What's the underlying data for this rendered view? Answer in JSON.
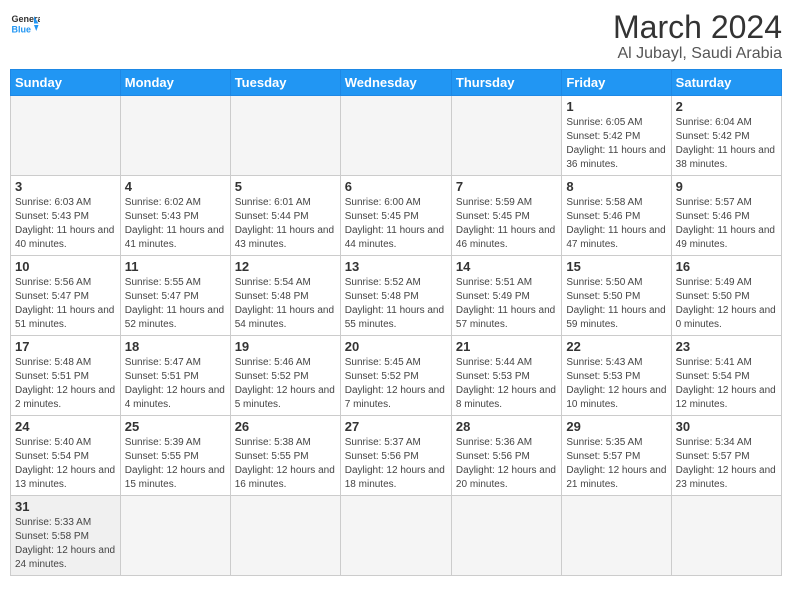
{
  "header": {
    "logo_general": "General",
    "logo_blue": "Blue",
    "title": "March 2024",
    "subtitle": "Al Jubayl, Saudi Arabia"
  },
  "weekdays": [
    "Sunday",
    "Monday",
    "Tuesday",
    "Wednesday",
    "Thursday",
    "Friday",
    "Saturday"
  ],
  "weeks": [
    [
      {
        "day": "",
        "info": ""
      },
      {
        "day": "",
        "info": ""
      },
      {
        "day": "",
        "info": ""
      },
      {
        "day": "",
        "info": ""
      },
      {
        "day": "",
        "info": ""
      },
      {
        "day": "1",
        "info": "Sunrise: 6:05 AM\nSunset: 5:42 PM\nDaylight: 11 hours and 36 minutes."
      },
      {
        "day": "2",
        "info": "Sunrise: 6:04 AM\nSunset: 5:42 PM\nDaylight: 11 hours and 38 minutes."
      }
    ],
    [
      {
        "day": "3",
        "info": "Sunrise: 6:03 AM\nSunset: 5:43 PM\nDaylight: 11 hours and 40 minutes."
      },
      {
        "day": "4",
        "info": "Sunrise: 6:02 AM\nSunset: 5:43 PM\nDaylight: 11 hours and 41 minutes."
      },
      {
        "day": "5",
        "info": "Sunrise: 6:01 AM\nSunset: 5:44 PM\nDaylight: 11 hours and 43 minutes."
      },
      {
        "day": "6",
        "info": "Sunrise: 6:00 AM\nSunset: 5:45 PM\nDaylight: 11 hours and 44 minutes."
      },
      {
        "day": "7",
        "info": "Sunrise: 5:59 AM\nSunset: 5:45 PM\nDaylight: 11 hours and 46 minutes."
      },
      {
        "day": "8",
        "info": "Sunrise: 5:58 AM\nSunset: 5:46 PM\nDaylight: 11 hours and 47 minutes."
      },
      {
        "day": "9",
        "info": "Sunrise: 5:57 AM\nSunset: 5:46 PM\nDaylight: 11 hours and 49 minutes."
      }
    ],
    [
      {
        "day": "10",
        "info": "Sunrise: 5:56 AM\nSunset: 5:47 PM\nDaylight: 11 hours and 51 minutes."
      },
      {
        "day": "11",
        "info": "Sunrise: 5:55 AM\nSunset: 5:47 PM\nDaylight: 11 hours and 52 minutes."
      },
      {
        "day": "12",
        "info": "Sunrise: 5:54 AM\nSunset: 5:48 PM\nDaylight: 11 hours and 54 minutes."
      },
      {
        "day": "13",
        "info": "Sunrise: 5:52 AM\nSunset: 5:48 PM\nDaylight: 11 hours and 55 minutes."
      },
      {
        "day": "14",
        "info": "Sunrise: 5:51 AM\nSunset: 5:49 PM\nDaylight: 11 hours and 57 minutes."
      },
      {
        "day": "15",
        "info": "Sunrise: 5:50 AM\nSunset: 5:50 PM\nDaylight: 11 hours and 59 minutes."
      },
      {
        "day": "16",
        "info": "Sunrise: 5:49 AM\nSunset: 5:50 PM\nDaylight: 12 hours and 0 minutes."
      }
    ],
    [
      {
        "day": "17",
        "info": "Sunrise: 5:48 AM\nSunset: 5:51 PM\nDaylight: 12 hours and 2 minutes."
      },
      {
        "day": "18",
        "info": "Sunrise: 5:47 AM\nSunset: 5:51 PM\nDaylight: 12 hours and 4 minutes."
      },
      {
        "day": "19",
        "info": "Sunrise: 5:46 AM\nSunset: 5:52 PM\nDaylight: 12 hours and 5 minutes."
      },
      {
        "day": "20",
        "info": "Sunrise: 5:45 AM\nSunset: 5:52 PM\nDaylight: 12 hours and 7 minutes."
      },
      {
        "day": "21",
        "info": "Sunrise: 5:44 AM\nSunset: 5:53 PM\nDaylight: 12 hours and 8 minutes."
      },
      {
        "day": "22",
        "info": "Sunrise: 5:43 AM\nSunset: 5:53 PM\nDaylight: 12 hours and 10 minutes."
      },
      {
        "day": "23",
        "info": "Sunrise: 5:41 AM\nSunset: 5:54 PM\nDaylight: 12 hours and 12 minutes."
      }
    ],
    [
      {
        "day": "24",
        "info": "Sunrise: 5:40 AM\nSunset: 5:54 PM\nDaylight: 12 hours and 13 minutes."
      },
      {
        "day": "25",
        "info": "Sunrise: 5:39 AM\nSunset: 5:55 PM\nDaylight: 12 hours and 15 minutes."
      },
      {
        "day": "26",
        "info": "Sunrise: 5:38 AM\nSunset: 5:55 PM\nDaylight: 12 hours and 16 minutes."
      },
      {
        "day": "27",
        "info": "Sunrise: 5:37 AM\nSunset: 5:56 PM\nDaylight: 12 hours and 18 minutes."
      },
      {
        "day": "28",
        "info": "Sunrise: 5:36 AM\nSunset: 5:56 PM\nDaylight: 12 hours and 20 minutes."
      },
      {
        "day": "29",
        "info": "Sunrise: 5:35 AM\nSunset: 5:57 PM\nDaylight: 12 hours and 21 minutes."
      },
      {
        "day": "30",
        "info": "Sunrise: 5:34 AM\nSunset: 5:57 PM\nDaylight: 12 hours and 23 minutes."
      }
    ],
    [
      {
        "day": "31",
        "info": "Sunrise: 5:33 AM\nSunset: 5:58 PM\nDaylight: 12 hours and 24 minutes."
      },
      {
        "day": "",
        "info": ""
      },
      {
        "day": "",
        "info": ""
      },
      {
        "day": "",
        "info": ""
      },
      {
        "day": "",
        "info": ""
      },
      {
        "day": "",
        "info": ""
      },
      {
        "day": "",
        "info": ""
      }
    ]
  ]
}
